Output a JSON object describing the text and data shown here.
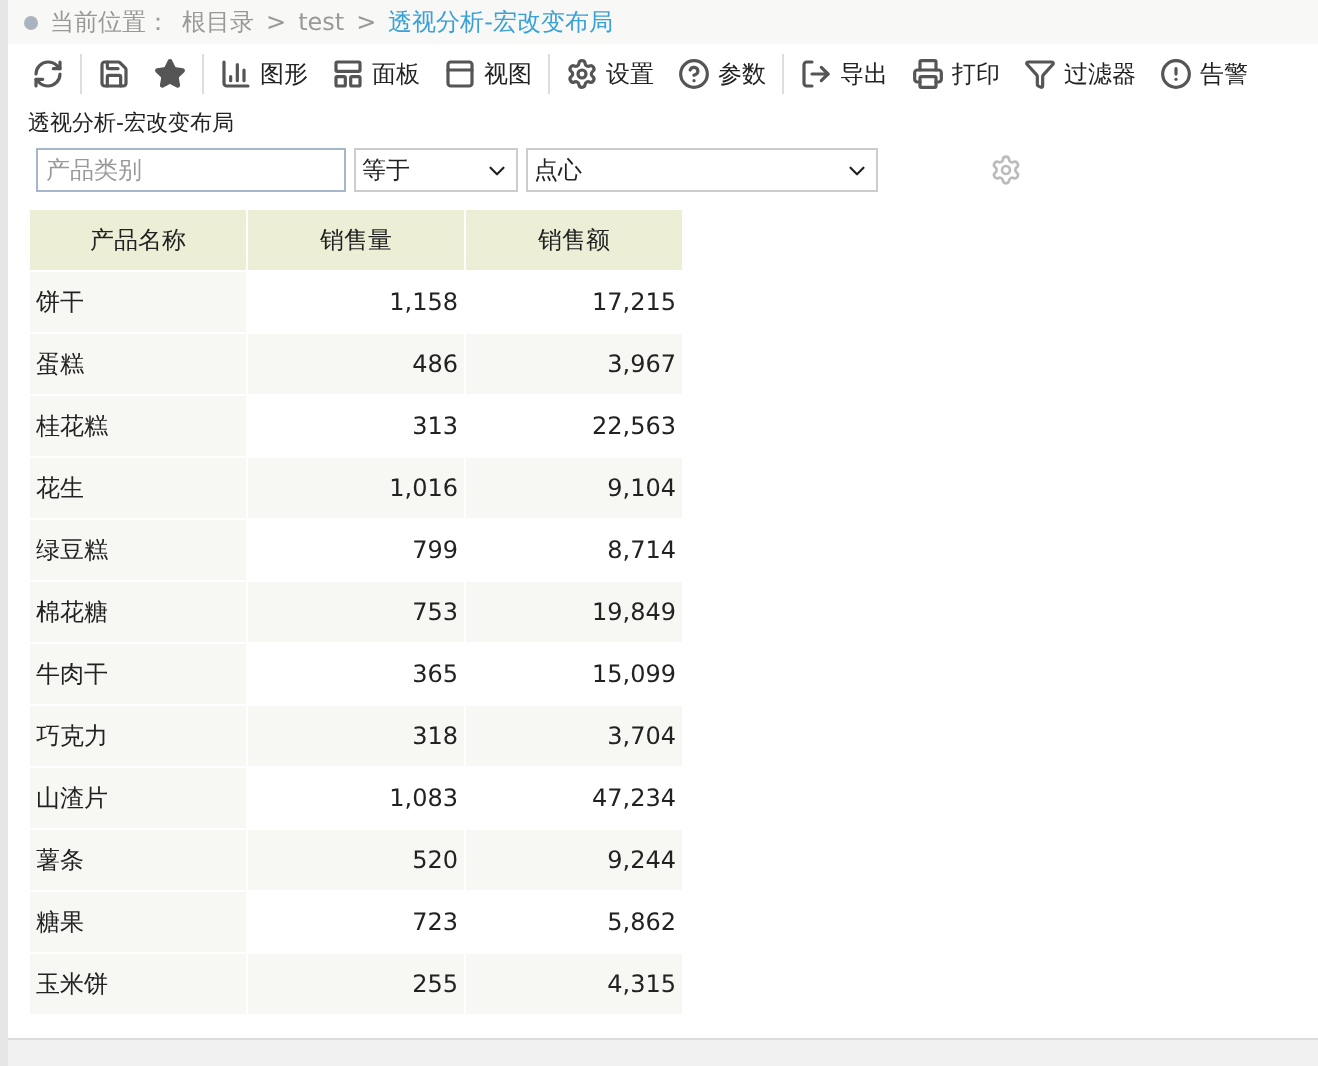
{
  "breadcrumb": {
    "label": "当前位置：",
    "items": [
      {
        "text": "根目录",
        "current": false
      },
      {
        "text": "test",
        "current": false
      },
      {
        "text": "透视分析-宏改变布局",
        "current": true
      }
    ],
    "separator": ">"
  },
  "toolbar": [
    {
      "kind": "refresh",
      "group_end": true
    },
    {
      "kind": "save"
    },
    {
      "kind": "star",
      "group_end": true
    },
    {
      "kind": "chart",
      "label": "图形"
    },
    {
      "kind": "panel",
      "label": "面板"
    },
    {
      "kind": "view",
      "label": "视图",
      "group_end": true
    },
    {
      "kind": "settings",
      "label": "设置"
    },
    {
      "kind": "help",
      "label": "参数",
      "group_end": true
    },
    {
      "kind": "export",
      "label": "导出"
    },
    {
      "kind": "print",
      "label": "打印"
    },
    {
      "kind": "filter",
      "label": "过滤器"
    },
    {
      "kind": "alert",
      "label": "告警"
    }
  ],
  "report_title": "透视分析-宏改变布局",
  "filter": {
    "field": {
      "placeholder": "产品类别"
    },
    "operator": "等于",
    "value": "点心"
  },
  "table": {
    "columns": [
      "产品名称",
      "销售量",
      "销售额"
    ],
    "rows": [
      [
        "饼干",
        "1,158",
        "17,215"
      ],
      [
        "蛋糕",
        "486",
        "3,967"
      ],
      [
        "桂花糕",
        "313",
        "22,563"
      ],
      [
        "花生",
        "1,016",
        "9,104"
      ],
      [
        "绿豆糕",
        "799",
        "8,714"
      ],
      [
        "棉花糖",
        "753",
        "19,849"
      ],
      [
        "牛肉干",
        "365",
        "15,099"
      ],
      [
        "巧克力",
        "318",
        "3,704"
      ],
      [
        "山渣片",
        "1,083",
        "47,234"
      ],
      [
        "薯条",
        "520",
        "9,244"
      ],
      [
        "糖果",
        "723",
        "5,862"
      ],
      [
        "玉米饼",
        "255",
        "4,315"
      ]
    ]
  }
}
